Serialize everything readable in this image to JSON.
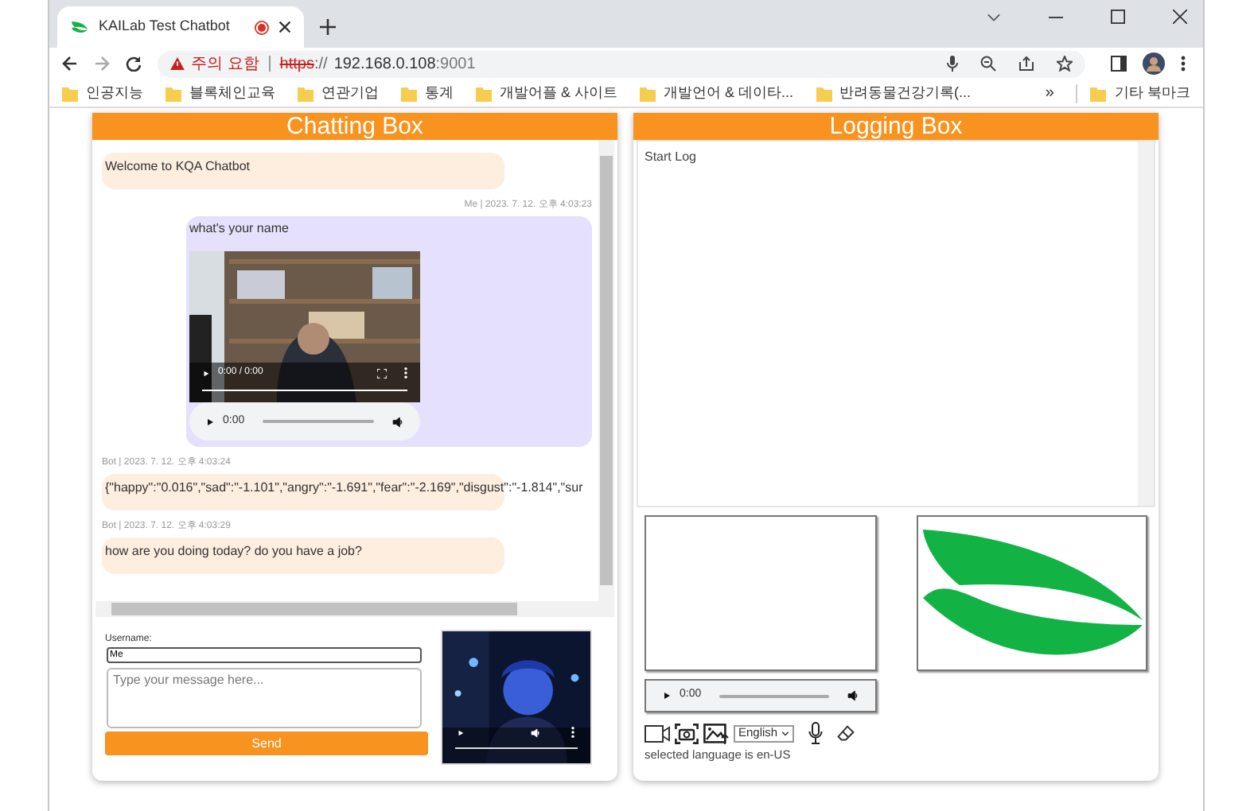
{
  "browser": {
    "tab_title": "KAILab Test Chatbot",
    "url": {
      "warning": "주의 요함",
      "scheme": "https",
      "separator": "://",
      "host": "192.168.0.108",
      "port": ":9001"
    },
    "bookmarks": [
      "인공지능",
      "블록체인교육",
      "연관기업",
      "통계",
      "개발어플 & 사이트",
      "개발언어 & 데이타...",
      "반려동물건강기록(..."
    ],
    "bookmarks_overflow": "»",
    "other_bookmarks": "기타 북마크"
  },
  "chat": {
    "title": "Chatting Box",
    "messages": [
      {
        "kind": "bot",
        "text": "Welcome to KQA Chatbot"
      },
      {
        "kind": "me",
        "meta": "Me | 2023. 7. 12. 오후 4:03:23",
        "text": "what's your name",
        "video_time": "0:00 / 0:00",
        "audio_time": "0:00"
      },
      {
        "kind": "bot",
        "meta": "Bot | 2023. 7. 12. 오후 4:03:24",
        "text": "{\"happy\":\"0.016\",\"sad\":\"-1.101\",\"angry\":\"-1.691\",\"fear\":\"-2.169\",\"disgust\":\"-1.814\",\"sur"
      },
      {
        "kind": "bot",
        "meta": "Bot | 2023. 7. 12. 오후 4:03:29",
        "text": "how are you doing today? do you have a job?"
      }
    ],
    "username_label": "Username:",
    "username_value": "Me",
    "message_placeholder": "Type your message here...",
    "send_label": "Send"
  },
  "log": {
    "title": "Logging Box",
    "lines": [
      "Start Log"
    ],
    "audio_time": "0:00",
    "language": "English",
    "status": "selected language is en-US"
  }
}
